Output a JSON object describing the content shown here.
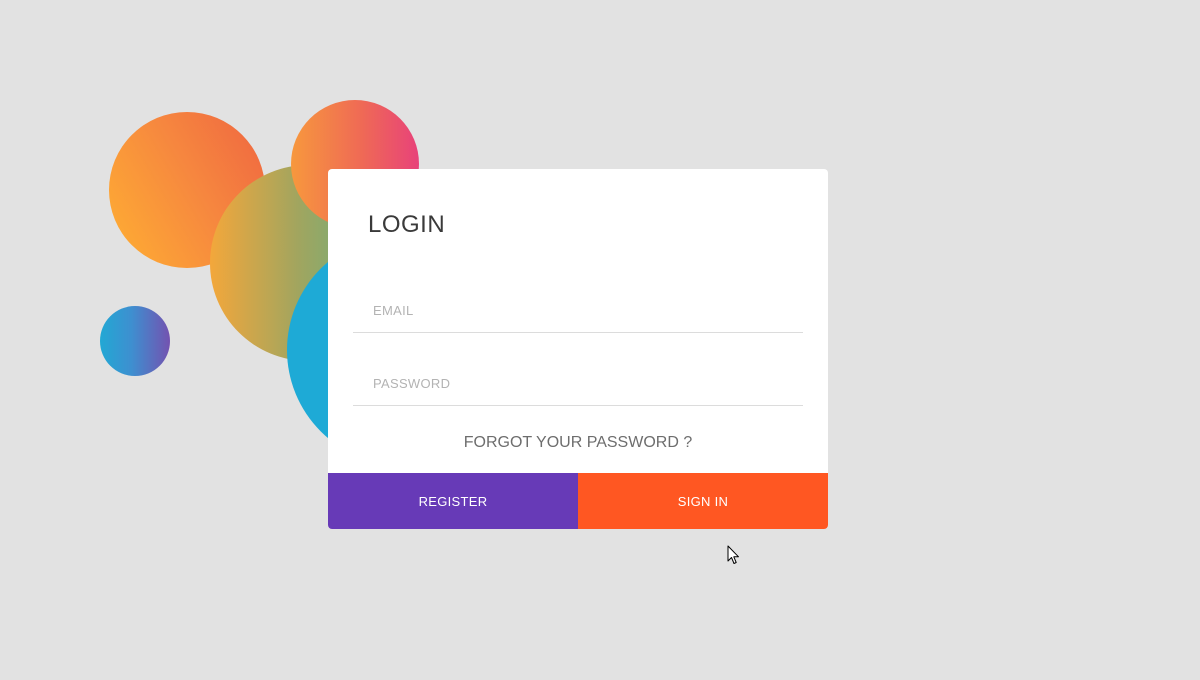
{
  "login": {
    "title": "LOGIN",
    "email_placeholder": "EMAIL",
    "password_placeholder": "PASSWORD",
    "forgot_label": "FORGOT YOUR PASSWORD ?",
    "register_label": "REGISTER",
    "signin_label": "SIGN IN"
  },
  "colors": {
    "background": "#e2e2e2",
    "register": "#673ab7",
    "signin": "#ff5722"
  },
  "icons": {
    "cursor": "mouse-pointer-icon"
  }
}
